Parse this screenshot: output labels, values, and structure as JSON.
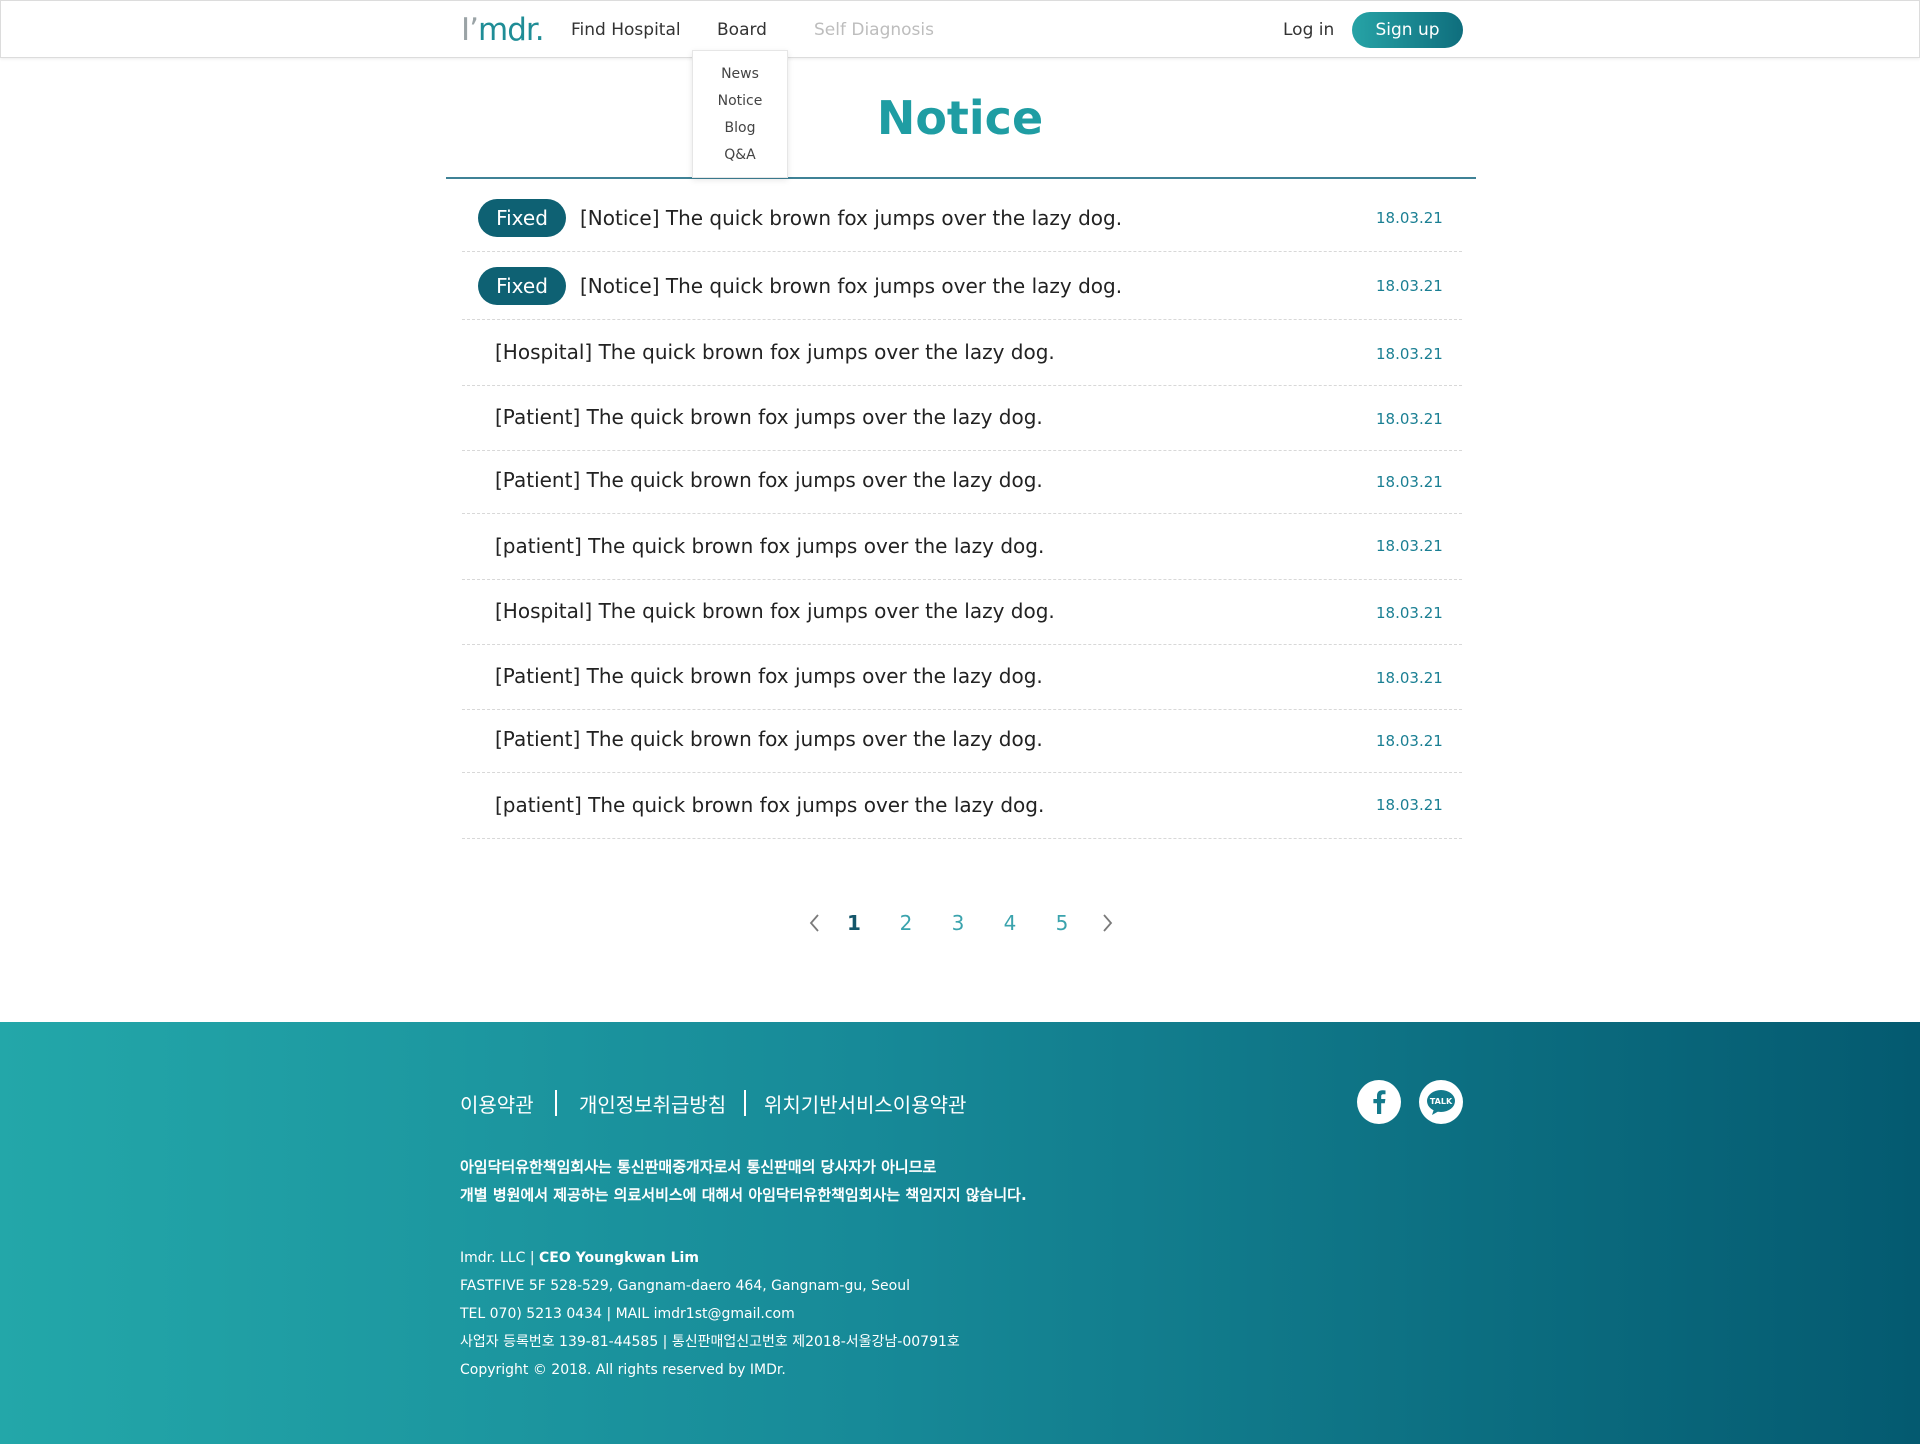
{
  "header": {
    "logo_i": "I’",
    "logo_rest": "mdr.",
    "nav": [
      "Find Hospital",
      "Board",
      "Self Diagnosis"
    ],
    "login": "Log in",
    "signup": "Sign up"
  },
  "board_menu": [
    "News",
    "Notice",
    "Blog",
    "Q&A"
  ],
  "page": {
    "title": "Notice"
  },
  "list": [
    {
      "badge": "Fixed",
      "title": "[Notice] The quick brown fox jumps over the lazy dog.",
      "date": "18.03.21"
    },
    {
      "badge": "Fixed",
      "title": "[Notice] The quick brown fox jumps over the lazy dog.",
      "date": "18.03.21"
    },
    {
      "badge": "",
      "title": "[Hospital] The quick brown fox jumps over the lazy dog.",
      "date": "18.03.21"
    },
    {
      "badge": "",
      "title": "[Patient] The quick brown fox jumps over the lazy dog.",
      "date": "18.03.21"
    },
    {
      "badge": "",
      "title": "[Patient] The quick brown fox jumps over the lazy dog.",
      "date": "18.03.21"
    },
    {
      "badge": "",
      "title": "[patient] The quick brown fox jumps over the lazy dog.",
      "date": "18.03.21"
    },
    {
      "badge": "",
      "title": "[Hospital] The quick brown fox jumps over the lazy dog.",
      "date": "18.03.21"
    },
    {
      "badge": "",
      "title": "[Patient] The quick brown fox jumps over the lazy dog.",
      "date": "18.03.21"
    },
    {
      "badge": "",
      "title": "[Patient] The quick brown fox jumps over the lazy dog.",
      "date": "18.03.21"
    },
    {
      "badge": "",
      "title": "[patient] The quick brown fox jumps over the lazy dog.",
      "date": "18.03.21"
    }
  ],
  "pagination": {
    "pages": [
      "1",
      "2",
      "3",
      "4",
      "5"
    ],
    "current": "1"
  },
  "footer": {
    "links": [
      "이용약관",
      "개인정보취급방침",
      "위치기반서비스이용약관"
    ],
    "notice": [
      "아임닥터유한책임회사는 통신판매중개자로서 통신판매의 당사자가 아니므로",
      "개별 병원에서 제공하는 의료서비스에 대해서 아임닥터유한책임회사는 책임지지 않습니다."
    ],
    "company_name": "Imdr. LLC",
    "ceo": "CEO Youngkwan Lim",
    "info": [
      "FASTFIVE 5F 528-529, Gangnam-daero 464, Gangnam-gu, Seoul",
      "TEL 070) 5213 0434 | MAIL  imdr1st@gmail.com",
      "사업자 등록번호 139-81-44585 | 통신판매업신고번호 제2018-서울강남-00791호",
      "Copyright © 2018. All rights reserved by IMDr."
    ],
    "social": [
      "facebook-icon",
      "kakaotalk-icon"
    ],
    "talk_label": "TALK"
  },
  "colors": {
    "brand": "#1f9da3",
    "badge": "#0e6173",
    "date": "#1a7f93",
    "footer_start": "#23a7a9",
    "footer_end": "#045a70"
  }
}
